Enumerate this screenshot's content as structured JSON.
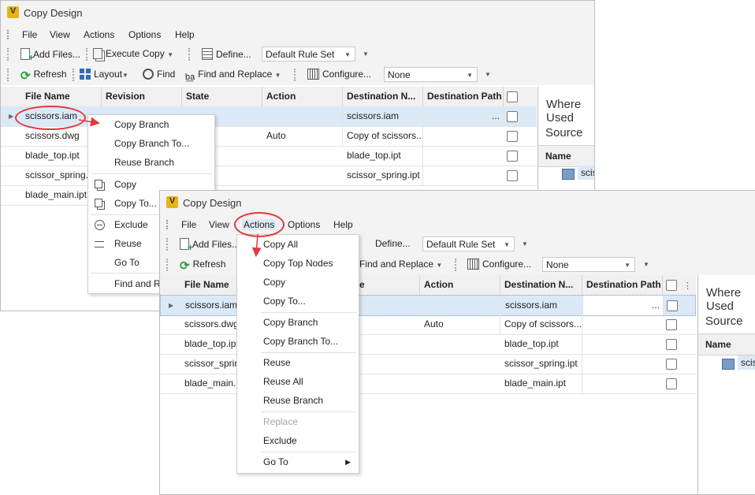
{
  "window": {
    "title": "Copy Design",
    "logo_letter": "V"
  },
  "menubar": [
    "File",
    "View",
    "Actions",
    "Options",
    "Help"
  ],
  "toolbar1": {
    "add_files": "Add Files...",
    "execute_copy": "Execute Copy",
    "define": "Define...",
    "rule_set": "Default Rule Set"
  },
  "toolbar1_front": {
    "add_files": "Add Files...",
    "define": "Define...",
    "rule_set": "Default Rule Set"
  },
  "toolbar2": {
    "refresh": "Refresh",
    "layout": "Layout",
    "find": "Find",
    "find_replace": "Find and Replace",
    "configure": "Configure...",
    "none_select": "None"
  },
  "toolbar2_front": {
    "refresh": "Refresh",
    "find_replace": "Find and Replace",
    "configure": "Configure...",
    "none_select": "None"
  },
  "columns": [
    "File Name",
    "Revision",
    "State",
    "Action",
    "Destination N...",
    "Destination Path"
  ],
  "columns_front": [
    "File Name",
    "te",
    "Action",
    "Destination N...",
    "Destination Path"
  ],
  "rows": [
    {
      "file": "scissors.iam",
      "action": "",
      "dest": "scissors.iam",
      "path": "..."
    },
    {
      "file": "scissors.dwg",
      "action": "Auto",
      "dest": "Copy of scissors...",
      "path": ""
    },
    {
      "file": "blade_top.ipt",
      "action": "",
      "dest": "blade_top.ipt",
      "path": ""
    },
    {
      "file": "scissor_spring.ipt",
      "action": "",
      "dest": "scissor_spring.ipt",
      "path": ""
    },
    {
      "file": "blade_main.ipt",
      "action": "",
      "dest": "",
      "path": ""
    }
  ],
  "rows_front": [
    {
      "file": "scissors.iam",
      "action": "",
      "dest": "scissors.iam",
      "path": "..."
    },
    {
      "file": "scissors.dwg",
      "action": "Auto",
      "dest": "Copy of scissors...",
      "path": ""
    },
    {
      "file": "blade_top.ipt",
      "action": "",
      "dest": "blade_top.ipt",
      "path": ""
    },
    {
      "file": "scissor_spring.ipt",
      "action": "",
      "dest": "scissor_spring.ipt",
      "path": ""
    },
    {
      "file": "blade_main.ipt",
      "action": "",
      "dest": "blade_main.ipt",
      "path": ""
    }
  ],
  "side_panel": {
    "title": "Where Used",
    "source": "Source",
    "name_header": "Name",
    "item": "scissors.iam"
  },
  "context_menu": [
    {
      "label": "Copy Branch",
      "icon": ""
    },
    {
      "label": "Copy Branch To...",
      "icon": ""
    },
    {
      "label": "Reuse Branch",
      "icon": ""
    },
    {
      "label": "Copy",
      "icon": "copy-icon"
    },
    {
      "label": "Copy To...",
      "icon": "copy-icon"
    },
    {
      "label": "Exclude",
      "icon": "exclude-icon"
    },
    {
      "label": "Reuse",
      "icon": "reuse-icon"
    },
    {
      "label": "Go To",
      "icon": ""
    },
    {
      "label": "Find and Re",
      "icon": ""
    }
  ],
  "actions_menu": [
    {
      "label": "Copy All",
      "disabled": false
    },
    {
      "label": "Copy Top Nodes",
      "disabled": false
    },
    {
      "label": "Copy",
      "disabled": false
    },
    {
      "label": "Copy To...",
      "disabled": false
    },
    {
      "label": "Copy Branch",
      "disabled": false
    },
    {
      "label": "Copy Branch To...",
      "disabled": false
    },
    {
      "label": "Reuse",
      "disabled": false
    },
    {
      "label": "Reuse All",
      "disabled": false
    },
    {
      "label": "Reuse Branch",
      "disabled": false
    },
    {
      "label": "Replace",
      "disabled": true
    },
    {
      "label": "Exclude",
      "disabled": false
    },
    {
      "label": "Go To",
      "disabled": false,
      "submenu": true
    }
  ],
  "colors": {
    "highlight": "#e0393e",
    "selection": "#dbe9f7",
    "accent_green": "#2e9c3a",
    "toolbar_bg": "#f3f3f3"
  }
}
